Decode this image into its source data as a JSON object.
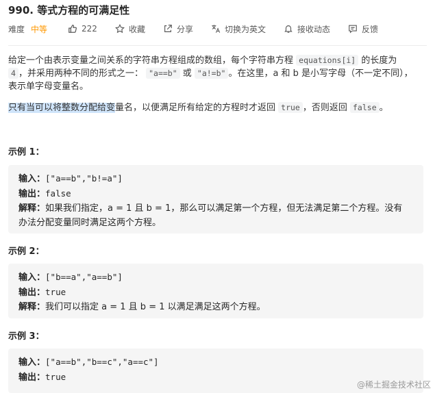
{
  "title": "990. 等式方程的可满足性",
  "meta": {
    "difficulty_label": "难度",
    "difficulty_value": "中等",
    "likes": "222",
    "favorite": "收藏",
    "share": "分享",
    "switch_lang": "切换为英文",
    "notify": "接收动态",
    "feedback": "反馈"
  },
  "description": {
    "p1_a": "给定一个由表示变量之间关系的字符串方程组成的数组，每个字符串方程 ",
    "p1_code1": "equations[i]",
    "p1_b": " 的长度为",
    "p1_code2": "4",
    "p1_c": "，并采用两种不同的形式之一：",
    "p1_code3": "\"a==b\"",
    "p1_d": " 或 ",
    "p1_code4": "\"a!=b\"",
    "p1_e": "。在这里，a 和 b 是小写字母（不一定不同），表示单字母变量名。",
    "p2_hl": "只有当可以将整数分配给变",
    "p2_a": "量名，以便满足所有给定的方程时才返回 ",
    "p2_code1": "true",
    "p2_b": "，否则返回 ",
    "p2_code2": "false",
    "p2_c": "。"
  },
  "examples": [
    {
      "title": "示例 1：",
      "input_label": "输入：",
      "input": "[\"a==b\",\"b!=a\"]",
      "output_label": "输出：",
      "output": "false",
      "explain_label": "解释：",
      "explain_1": "如果我们指定，a = 1 且 b = 1，那么可以满足第一个方程，但无法满足第二个方程。没有",
      "explain_2": "办法分配变量同时满足这两个方程。"
    },
    {
      "title": "示例 2：",
      "input_label": "输入：",
      "input": "[\"b==a\",\"a==b\"]",
      "output_label": "输出：",
      "output": "true",
      "explain_label": "解释：",
      "explain_1": "我们可以指定 a = 1 且 b = 1 以满足满足这两个方程。"
    },
    {
      "title": "示例 3：",
      "input_label": "输入：",
      "input": "[\"a==b\",\"b==c\",\"a==c\"]",
      "output_label": "输出：",
      "output": "true"
    }
  ],
  "watermark": "@稀土掘金技术社区",
  "colors": {
    "difficulty_medium": "#ff9800",
    "highlight": "#cfe4fa",
    "code_bg": "#f3f4f5",
    "example_bg": "#f5f5f5"
  }
}
